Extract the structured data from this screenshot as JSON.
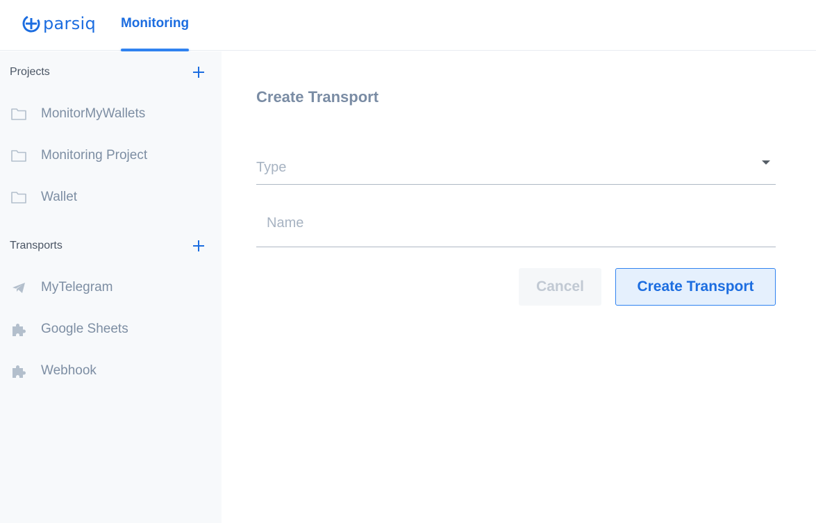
{
  "header": {
    "logo_text": "parsiq",
    "nav_tab": "Monitoring"
  },
  "sidebar": {
    "projects": {
      "title": "Projects",
      "items": [
        {
          "label": "MonitorMyWallets",
          "icon": "folder-icon"
        },
        {
          "label": "Monitoring Project",
          "icon": "folder-icon"
        },
        {
          "label": "Wallet",
          "icon": "folder-icon"
        }
      ]
    },
    "transports": {
      "title": "Transports",
      "items": [
        {
          "label": "MyTelegram",
          "icon": "telegram-icon"
        },
        {
          "label": "Google Sheets",
          "icon": "puzzle-icon"
        },
        {
          "label": "Webhook",
          "icon": "puzzle-icon"
        }
      ]
    }
  },
  "main": {
    "title": "Create Transport",
    "type_placeholder": "Type",
    "name_placeholder": "Name",
    "cancel_label": "Cancel",
    "create_label": "Create Transport"
  },
  "colors": {
    "accent": "#1c6de0",
    "sidebar_bg": "#f7f9fb",
    "muted_text": "#7d8ea3"
  }
}
